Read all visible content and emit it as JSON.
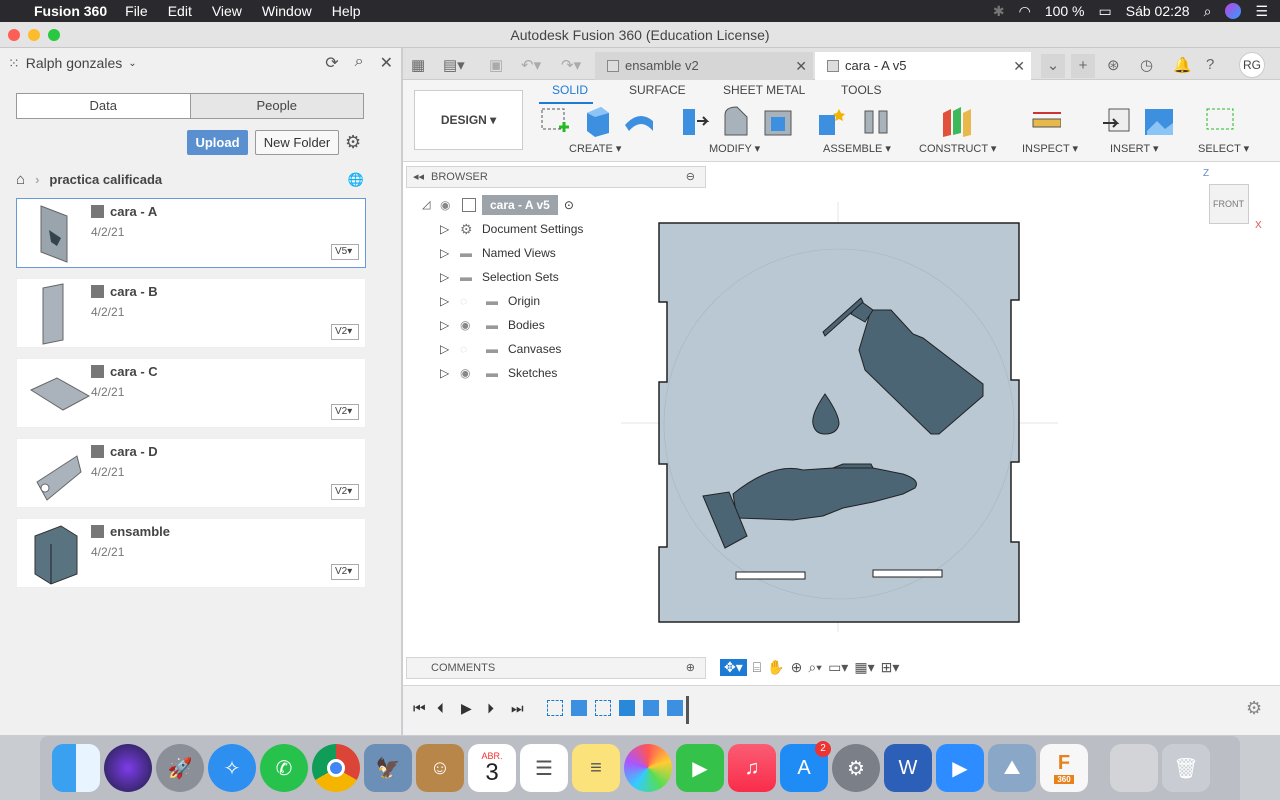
{
  "menubar": {
    "app": "Fusion 360",
    "menus": [
      "File",
      "Edit",
      "View",
      "Window",
      "Help"
    ],
    "battery": "100 %",
    "clock": "Sáb 02:28"
  },
  "window": {
    "title": "Autodesk Fusion 360 (Education License)"
  },
  "data_panel": {
    "user": "Ralph gonzales",
    "segments": [
      "Data",
      "People"
    ],
    "upload": "Upload",
    "new_folder": "New Folder",
    "breadcrumb": "practica calificada",
    "items": [
      {
        "name": "cara - A",
        "date": "4/2/21",
        "version": "V5"
      },
      {
        "name": "cara - B",
        "date": "4/2/21",
        "version": "V2"
      },
      {
        "name": "cara - C",
        "date": "4/2/21",
        "version": "V2"
      },
      {
        "name": "cara - D",
        "date": "4/2/21",
        "version": "V2"
      },
      {
        "name": "ensamble",
        "date": "4/2/21",
        "version": "V2"
      }
    ]
  },
  "tabs": [
    {
      "label": "ensamble v2"
    },
    {
      "label": "cara - A v5"
    }
  ],
  "toolbar": {
    "initials": "RG",
    "workspace": "DESIGN",
    "ribbon_tabs": [
      "SOLID",
      "SURFACE",
      "SHEET METAL",
      "TOOLS"
    ],
    "groups": [
      "CREATE",
      "MODIFY",
      "ASSEMBLE",
      "CONSTRUCT",
      "INSPECT",
      "INSERT",
      "SELECT"
    ]
  },
  "browser": {
    "title": "BROWSER",
    "root": "cara - A v5",
    "nodes": [
      "Document Settings",
      "Named Views",
      "Selection Sets",
      "Origin",
      "Bodies",
      "Canvases",
      "Sketches"
    ]
  },
  "viewcube": {
    "face": "FRONT",
    "axis_z": "Z",
    "axis_x": "X"
  },
  "comments": {
    "title": "COMMENTS"
  },
  "dock": {
    "calendar_month": "ABR.",
    "calendar_day": "3",
    "appstore_badge": "2",
    "fusion_label": "360"
  }
}
